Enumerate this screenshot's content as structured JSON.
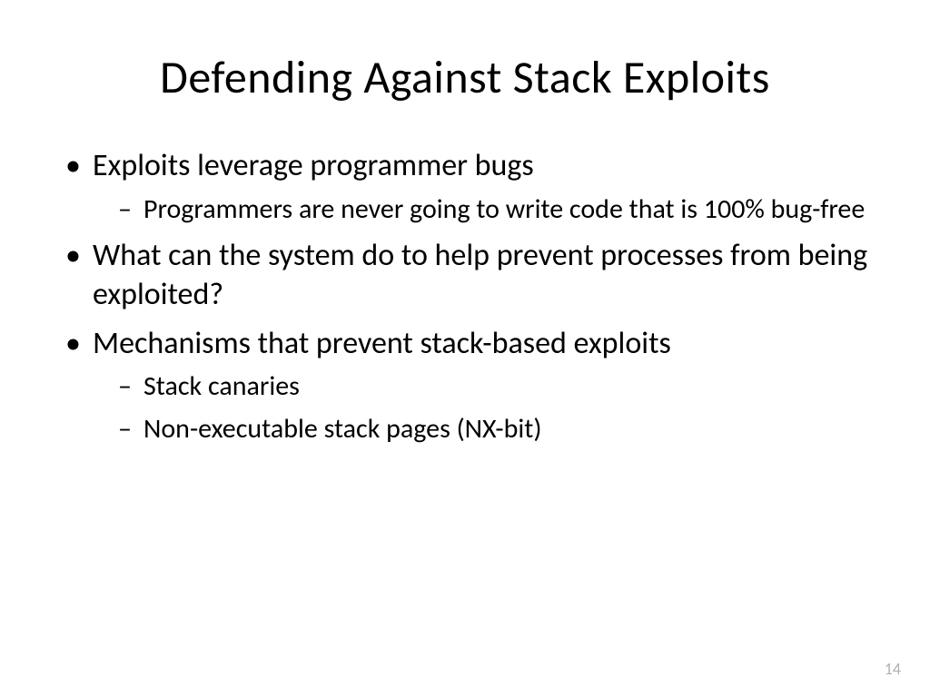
{
  "slide": {
    "title": "Defending Against Stack Exploits",
    "bullets": [
      {
        "text": "Exploits leverage programmer bugs",
        "sub": [
          "Programmers are never going to write code that is 100% bug-free"
        ]
      },
      {
        "text": "What can the system do to help prevent processes from being exploited?",
        "sub": []
      },
      {
        "text": "Mechanisms that prevent stack-based exploits",
        "sub": [
          "Stack canaries",
          "Non-executable stack pages (NX-bit)"
        ]
      }
    ],
    "page_number": "14"
  }
}
